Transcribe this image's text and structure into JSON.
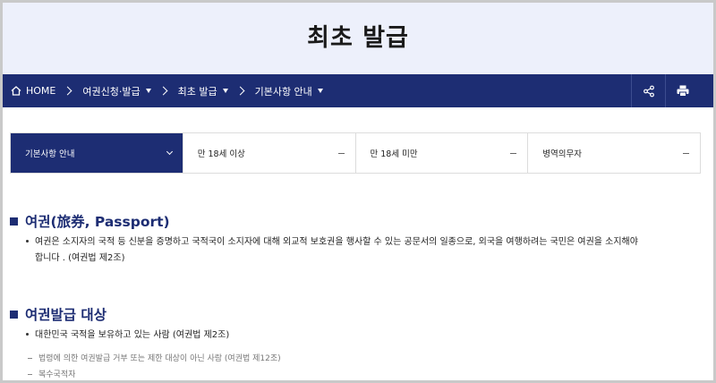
{
  "page": {
    "title": "최초 발급"
  },
  "nav": {
    "home_label": "HOME",
    "crumbs": [
      "여권신청·발급",
      "최초 발급",
      "기본사항 안내"
    ]
  },
  "tabs": [
    "기본사항 안내",
    "만 18세 이상",
    "만 18세 미만",
    "병역의무자"
  ],
  "sections": {
    "passport": {
      "title": "여권(旅券, Passport)",
      "line1": "여권은 소지자의 국적 등 신분을 증명하고 국적국이 소지자에 대해 외교적 보호권을 행사할 수 있는 공문서의 일종으로, 외국을 여행하려는 국민은 여권을 소지해야",
      "line2": "합니다 . (여권법 제2조)"
    },
    "target": {
      "title": "여권발급 대상",
      "bullet": "대한민국 국적을 보유하고 있는 사람 (여권법 제2조)",
      "sub1": "법령에 의한 여권발급 거부 또는 제한 대상이 아닌 사람 (여권법 제12조)",
      "sub2": "복수국적자"
    }
  },
  "colors": {
    "navy": "#1d2d73",
    "hero_bg": "#edf0fb"
  }
}
